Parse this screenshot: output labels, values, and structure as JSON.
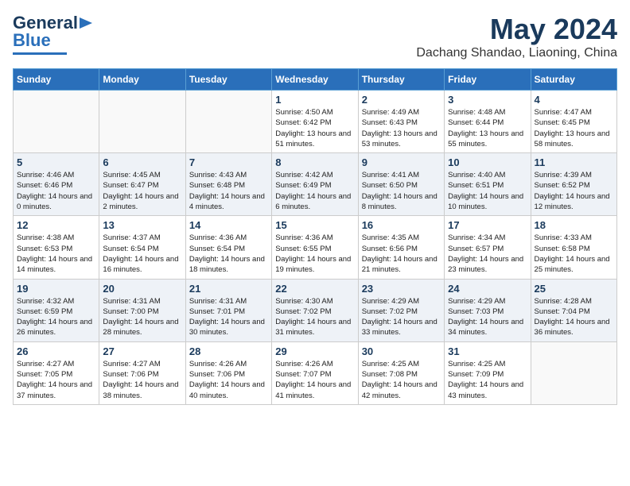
{
  "header": {
    "logo_line1": "General",
    "logo_line2": "Blue",
    "month": "May 2024",
    "location": "Dachang Shandao, Liaoning, China"
  },
  "days_of_week": [
    "Sunday",
    "Monday",
    "Tuesday",
    "Wednesday",
    "Thursday",
    "Friday",
    "Saturday"
  ],
  "weeks": [
    [
      {
        "day": null
      },
      {
        "day": null
      },
      {
        "day": null
      },
      {
        "day": "1",
        "sunrise": "4:50 AM",
        "sunset": "6:42 PM",
        "daylight": "13 hours and 51 minutes."
      },
      {
        "day": "2",
        "sunrise": "4:49 AM",
        "sunset": "6:43 PM",
        "daylight": "13 hours and 53 minutes."
      },
      {
        "day": "3",
        "sunrise": "4:48 AM",
        "sunset": "6:44 PM",
        "daylight": "13 hours and 55 minutes."
      },
      {
        "day": "4",
        "sunrise": "4:47 AM",
        "sunset": "6:45 PM",
        "daylight": "13 hours and 58 minutes."
      }
    ],
    [
      {
        "day": "5",
        "sunrise": "4:46 AM",
        "sunset": "6:46 PM",
        "daylight": "14 hours and 0 minutes."
      },
      {
        "day": "6",
        "sunrise": "4:45 AM",
        "sunset": "6:47 PM",
        "daylight": "14 hours and 2 minutes."
      },
      {
        "day": "7",
        "sunrise": "4:43 AM",
        "sunset": "6:48 PM",
        "daylight": "14 hours and 4 minutes."
      },
      {
        "day": "8",
        "sunrise": "4:42 AM",
        "sunset": "6:49 PM",
        "daylight": "14 hours and 6 minutes."
      },
      {
        "day": "9",
        "sunrise": "4:41 AM",
        "sunset": "6:50 PM",
        "daylight": "14 hours and 8 minutes."
      },
      {
        "day": "10",
        "sunrise": "4:40 AM",
        "sunset": "6:51 PM",
        "daylight": "14 hours and 10 minutes."
      },
      {
        "day": "11",
        "sunrise": "4:39 AM",
        "sunset": "6:52 PM",
        "daylight": "14 hours and 12 minutes."
      }
    ],
    [
      {
        "day": "12",
        "sunrise": "4:38 AM",
        "sunset": "6:53 PM",
        "daylight": "14 hours and 14 minutes."
      },
      {
        "day": "13",
        "sunrise": "4:37 AM",
        "sunset": "6:54 PM",
        "daylight": "14 hours and 16 minutes."
      },
      {
        "day": "14",
        "sunrise": "4:36 AM",
        "sunset": "6:54 PM",
        "daylight": "14 hours and 18 minutes."
      },
      {
        "day": "15",
        "sunrise": "4:36 AM",
        "sunset": "6:55 PM",
        "daylight": "14 hours and 19 minutes."
      },
      {
        "day": "16",
        "sunrise": "4:35 AM",
        "sunset": "6:56 PM",
        "daylight": "14 hours and 21 minutes."
      },
      {
        "day": "17",
        "sunrise": "4:34 AM",
        "sunset": "6:57 PM",
        "daylight": "14 hours and 23 minutes."
      },
      {
        "day": "18",
        "sunrise": "4:33 AM",
        "sunset": "6:58 PM",
        "daylight": "14 hours and 25 minutes."
      }
    ],
    [
      {
        "day": "19",
        "sunrise": "4:32 AM",
        "sunset": "6:59 PM",
        "daylight": "14 hours and 26 minutes."
      },
      {
        "day": "20",
        "sunrise": "4:31 AM",
        "sunset": "7:00 PM",
        "daylight": "14 hours and 28 minutes."
      },
      {
        "day": "21",
        "sunrise": "4:31 AM",
        "sunset": "7:01 PM",
        "daylight": "14 hours and 30 minutes."
      },
      {
        "day": "22",
        "sunrise": "4:30 AM",
        "sunset": "7:02 PM",
        "daylight": "14 hours and 31 minutes."
      },
      {
        "day": "23",
        "sunrise": "4:29 AM",
        "sunset": "7:02 PM",
        "daylight": "14 hours and 33 minutes."
      },
      {
        "day": "24",
        "sunrise": "4:29 AM",
        "sunset": "7:03 PM",
        "daylight": "14 hours and 34 minutes."
      },
      {
        "day": "25",
        "sunrise": "4:28 AM",
        "sunset": "7:04 PM",
        "daylight": "14 hours and 36 minutes."
      }
    ],
    [
      {
        "day": "26",
        "sunrise": "4:27 AM",
        "sunset": "7:05 PM",
        "daylight": "14 hours and 37 minutes."
      },
      {
        "day": "27",
        "sunrise": "4:27 AM",
        "sunset": "7:06 PM",
        "daylight": "14 hours and 38 minutes."
      },
      {
        "day": "28",
        "sunrise": "4:26 AM",
        "sunset": "7:06 PM",
        "daylight": "14 hours and 40 minutes."
      },
      {
        "day": "29",
        "sunrise": "4:26 AM",
        "sunset": "7:07 PM",
        "daylight": "14 hours and 41 minutes."
      },
      {
        "day": "30",
        "sunrise": "4:25 AM",
        "sunset": "7:08 PM",
        "daylight": "14 hours and 42 minutes."
      },
      {
        "day": "31",
        "sunrise": "4:25 AM",
        "sunset": "7:09 PM",
        "daylight": "14 hours and 43 minutes."
      },
      {
        "day": null
      }
    ]
  ]
}
